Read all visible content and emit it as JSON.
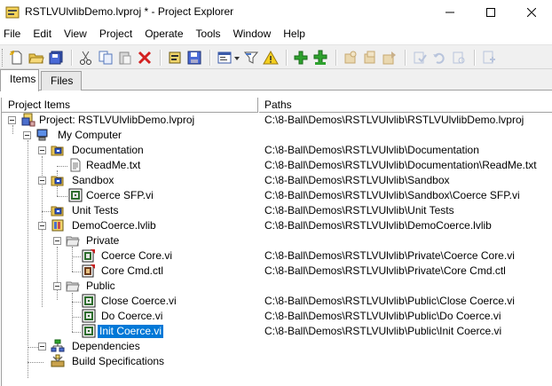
{
  "window": {
    "title": "RSTLVUlvlibDemo.lvproj * - Project Explorer"
  },
  "menu": [
    "File",
    "Edit",
    "View",
    "Project",
    "Operate",
    "Tools",
    "Window",
    "Help"
  ],
  "tabs": [
    {
      "label": "Items",
      "active": true
    },
    {
      "label": "Files",
      "active": false
    }
  ],
  "columns": {
    "items": "Project Items",
    "paths": "Paths"
  },
  "tree": [
    {
      "label": "Project: RSTLVUlvlibDemo.lvproj",
      "path": "C:\\8-Ball\\Demos\\RSTLVUlvlib\\RSTLVUlvlibDemo.lvproj",
      "icon": "project-icon"
    },
    {
      "label": "My Computer",
      "path": "",
      "icon": "computer-icon"
    },
    {
      "label": "Documentation",
      "path": "C:\\8-Ball\\Demos\\RSTLVUlvlib\\Documentation",
      "icon": "autopopulating-folder-icon"
    },
    {
      "label": "ReadMe.txt",
      "path": "C:\\8-Ball\\Demos\\RSTLVUlvlib\\Documentation\\ReadMe.txt",
      "icon": "text-file-icon"
    },
    {
      "label": "Sandbox",
      "path": "C:\\8-Ball\\Demos\\RSTLVUlvlib\\Sandbox",
      "icon": "autopopulating-folder-icon"
    },
    {
      "label": "Coerce SFP.vi",
      "path": "C:\\8-Ball\\Demos\\RSTLVUlvlib\\Sandbox\\Coerce SFP.vi",
      "icon": "vi-icon"
    },
    {
      "label": "Unit Tests",
      "path": "C:\\8-Ball\\Demos\\RSTLVUlvlib\\Unit Tests",
      "icon": "autopopulating-folder-icon"
    },
    {
      "label": "DemoCoerce.lvlib",
      "path": "C:\\8-Ball\\Demos\\RSTLVUlvlib\\DemoCoerce.lvlib",
      "icon": "library-icon"
    },
    {
      "label": "Private",
      "path": "",
      "icon": "virtual-folder-icon"
    },
    {
      "label": "Coerce Core.vi",
      "path": "C:\\8-Ball\\Demos\\RSTLVUlvlib\\Private\\Coerce Core.vi",
      "icon": "private-vi-icon"
    },
    {
      "label": "Core Cmd.ctl",
      "path": "C:\\8-Ball\\Demos\\RSTLVUlvlib\\Private\\Core Cmd.ctl",
      "icon": "private-ctl-icon"
    },
    {
      "label": "Public",
      "path": "",
      "icon": "virtual-folder-icon"
    },
    {
      "label": "Close Coerce.vi",
      "path": "C:\\8-Ball\\Demos\\RSTLVUlvlib\\Public\\Close Coerce.vi",
      "icon": "vi-icon"
    },
    {
      "label": "Do Coerce.vi",
      "path": "C:\\8-Ball\\Demos\\RSTLVUlvlib\\Public\\Do Coerce.vi",
      "icon": "vi-icon"
    },
    {
      "label": "Init Coerce.vi",
      "path": "C:\\8-Ball\\Demos\\RSTLVUlvlib\\Public\\Init Coerce.vi",
      "icon": "vi-icon",
      "selected": true
    },
    {
      "label": "Dependencies",
      "path": "",
      "icon": "dependencies-icon"
    },
    {
      "label": "Build Specifications",
      "path": "",
      "icon": "build-specifications-icon"
    }
  ],
  "colors": {
    "selection": "#0078d7",
    "folder": "#e9c552",
    "autopop_folder_badge": "#2f57c9"
  }
}
